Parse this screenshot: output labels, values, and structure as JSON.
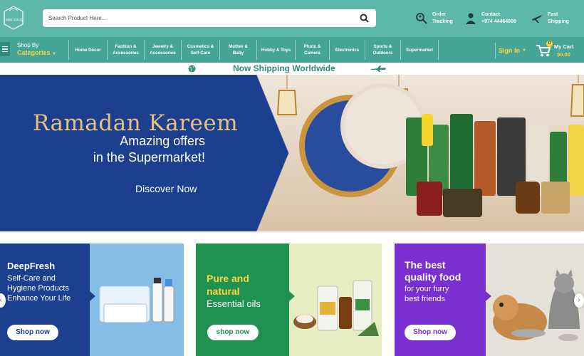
{
  "header": {
    "logo_text": "MINI SOUQ",
    "search": {
      "placeholder": "Search Product Here..."
    },
    "links": [
      {
        "line1": "Order",
        "line2": "Tracking",
        "icon": "search-pin-icon"
      },
      {
        "line1": "Contact",
        "line2": "+974 44464000",
        "icon": "phone-user-icon"
      },
      {
        "line1": "Fast",
        "line2": "Shipping",
        "icon": "airplane-icon"
      }
    ]
  },
  "category_bar": {
    "shop_by": "Shop By",
    "categories_label": "Categories",
    "items": [
      {
        "l1": "Home Décor",
        "l2": ""
      },
      {
        "l1": "Fashion &",
        "l2": "Accessories"
      },
      {
        "l1": "Jewelry &",
        "l2": "Accessories"
      },
      {
        "l1": "Cosmetics &",
        "l2": "Self-Care"
      },
      {
        "l1": "Mother &",
        "l2": "Baby"
      },
      {
        "l1": "Hobby & Toys",
        "l2": ""
      },
      {
        "l1": "Photo &",
        "l2": "Camera"
      },
      {
        "l1": "Electronics",
        "l2": ""
      },
      {
        "l1": "Sports &",
        "l2": "Outdoors"
      },
      {
        "l1": "Supermarket",
        "l2": ""
      }
    ],
    "sign_in": "Sign In",
    "cart": {
      "label": "My Cart",
      "amount": "$0.00",
      "count": "0"
    }
  },
  "shipping_strip": {
    "text": "Now Shipping Worldwide"
  },
  "hero": {
    "title": "Ramadan Kareem",
    "subtitle_line1": "Amazing offers",
    "subtitle_line2": "in the Supermarket!",
    "cta": "Discover Now"
  },
  "promos": [
    {
      "title": "DeepFresh",
      "body": [
        "Self-Care and",
        "Hygiene Products",
        "Enhance Your Life"
      ],
      "button": "Shop now",
      "color": "#1d3f8f"
    },
    {
      "title": [
        "Pure and",
        "natural"
      ],
      "body": [
        "Essential oils"
      ],
      "button": "shop now",
      "color": "#1f9150"
    },
    {
      "title": [
        "The best",
        "quality food"
      ],
      "body": [
        "for your furry",
        "best friends"
      ],
      "button": "Shop now",
      "color": "#7a2fd0"
    }
  ],
  "colors": {
    "header": "#5db8a8",
    "category_bar": "#45a596",
    "accent_yellow": "#ffd23c",
    "hero_blue": "#1d3f8f",
    "hero_gold": "#e6c27a"
  }
}
